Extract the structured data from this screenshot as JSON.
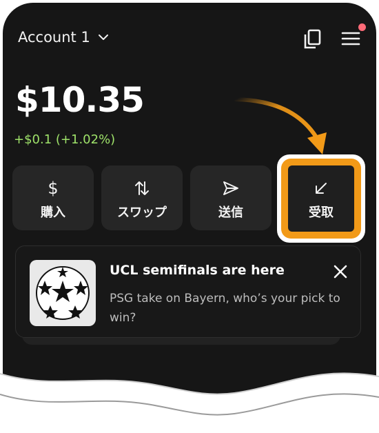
{
  "header": {
    "account_label": "Account 1",
    "icons": [
      "chevron-down-icon",
      "copy-icon",
      "menu-icon"
    ],
    "notification_dot_color": "#ff6b78"
  },
  "wallet": {
    "balance": "$10.35",
    "change": "+$0.1 (+1.02%)",
    "change_color": "#9fe36a"
  },
  "actions": [
    {
      "label": "購入",
      "icon": "dollar-icon"
    },
    {
      "label": "スワップ",
      "icon": "swap-arrows-icon"
    },
    {
      "label": "送信",
      "icon": "send-icon"
    },
    {
      "label": "受取",
      "icon": "receive-arrow-icon",
      "highlighted": true
    }
  ],
  "promo": {
    "title": "UCL semifinals are here",
    "text": "PSG take on Bayern, who’s your pick to win?",
    "image_icon": "champions-league-ball-icon",
    "close_icon": "close-icon"
  },
  "highlight_color": "#f29a18"
}
